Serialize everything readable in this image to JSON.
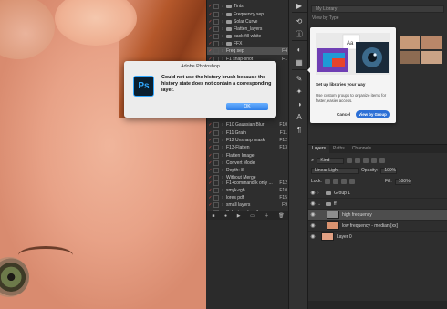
{
  "dialog": {
    "title": "Adobe Photoshop",
    "message": "Could not use the history brush because the history state does not contain a corresponding layer.",
    "ok_label": "OK",
    "icon_text": "Ps"
  },
  "history": {
    "items": [
      {
        "label": "Tints",
        "key": ""
      },
      {
        "label": "Frequency sep",
        "key": ""
      },
      {
        "label": "Solar Curve",
        "key": ""
      },
      {
        "label": "Flatten_layers",
        "key": ""
      },
      {
        "label": "back-fill-white",
        "key": ""
      },
      {
        "label": "FFX",
        "key": ""
      },
      {
        "label": "Freq sep",
        "key": "F4"
      },
      {
        "label": "F1 snap-shot",
        "key": "F1"
      },
      {
        "label": "F10 Gaussian Blur",
        "key": "F10"
      },
      {
        "label": "F11 Grain",
        "key": "F11"
      },
      {
        "label": "F12 Unsharp mask",
        "key": "F12"
      },
      {
        "label": "F13-Flatten",
        "key": "F13"
      },
      {
        "label": "Flatten Image",
        "key": ""
      },
      {
        "label": "Convert Mode",
        "key": ""
      },
      {
        "label": "Depth: 8",
        "key": ""
      },
      {
        "label": "Without Merge",
        "key": ""
      },
      {
        "label": "F1+command k only ...",
        "key": "F12"
      },
      {
        "label": "smyk-rgb",
        "key": "F10"
      },
      {
        "label": "lores pdf",
        "key": "F15"
      },
      {
        "label": "small layers",
        "key": "F9"
      },
      {
        "label": "Select work path",
        "key": ""
      }
    ]
  },
  "libraries": {
    "selector_label": "My Library",
    "view_by": "View by Type"
  },
  "popup": {
    "title": "Set up libraries your way",
    "description": "Use custom groups to organize items for faster, easier access.",
    "cancel_label": "Cancel",
    "view_by_group_label": "View by Group",
    "illus_tag": "Aa"
  },
  "layers": {
    "tabs": [
      {
        "label": "Layers",
        "active": true
      },
      {
        "label": "Paths",
        "active": false
      },
      {
        "label": "Channels",
        "active": false
      }
    ],
    "kind_label": "Kind",
    "blend_mode": "Linear Light",
    "opacity_label": "Opacity:",
    "opacity_value": "100%",
    "lock_label": "Lock:",
    "fill_label": "Fill:",
    "fill_value": "100%",
    "items": [
      {
        "name": "Group 1",
        "type": "group"
      },
      {
        "name": "ff",
        "type": "group"
      },
      {
        "name": "high frequency",
        "type": "layer"
      },
      {
        "name": "low frequency - median [xx]",
        "type": "layer"
      },
      {
        "name": "Layer 0",
        "type": "layer"
      }
    ]
  },
  "colors": {
    "accent": "#2d70d6",
    "dialog_bg": "#ececec",
    "panel_bg": "#2e2e2e"
  }
}
